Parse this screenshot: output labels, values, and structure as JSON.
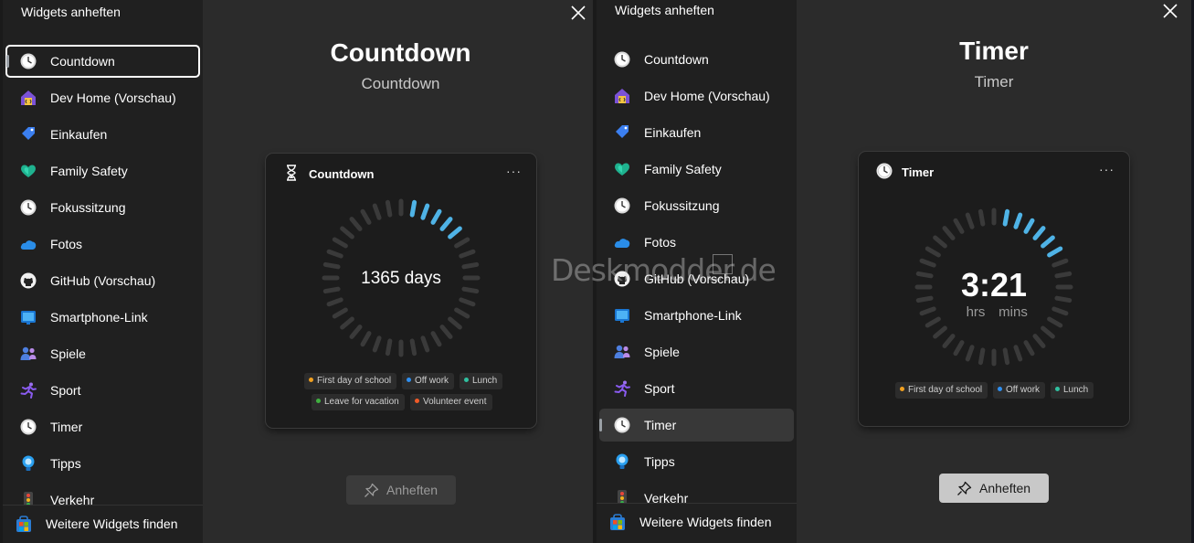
{
  "left": {
    "sidebar_title": "Widgets anheften",
    "items": [
      {
        "label": "Countdown",
        "icon": "clock-icon"
      },
      {
        "label": "Dev Home (Vorschau)",
        "icon": "dev-home-icon"
      },
      {
        "label": "Einkaufen",
        "icon": "shopping-tag-icon"
      },
      {
        "label": "Family Safety",
        "icon": "family-safety-heart-icon"
      },
      {
        "label": "Fokussitzung",
        "icon": "clock-icon"
      },
      {
        "label": "Fotos",
        "icon": "cloud-icon"
      },
      {
        "label": "GitHub (Vorschau)",
        "icon": "github-icon"
      },
      {
        "label": "Smartphone-Link",
        "icon": "phone-link-icon"
      },
      {
        "label": "Spiele",
        "icon": "games-icon"
      },
      {
        "label": "Sport",
        "icon": "runner-icon"
      },
      {
        "label": "Timer",
        "icon": "clock-icon"
      },
      {
        "label": "Tipps",
        "icon": "lightbulb-icon"
      },
      {
        "label": "Verkehr",
        "icon": "traffic-light-icon"
      }
    ],
    "footer_label": "Weitere Widgets finden",
    "title": "Countdown",
    "subtitle": "Countdown",
    "card": {
      "title": "Countdown",
      "more": "···",
      "value": "1365 days",
      "chips": [
        {
          "label": "First day of school",
          "color": "#f0a020"
        },
        {
          "label": "Off work",
          "color": "#2f8ff0"
        },
        {
          "label": "Lunch",
          "color": "#30c0a0"
        },
        {
          "label": "Leave for vacation",
          "color": "#40b040"
        },
        {
          "label": "Volunteer event",
          "color": "#f05a28"
        }
      ]
    },
    "pin_label": "Anheften"
  },
  "right": {
    "sidebar_title": "Widgets anheften",
    "items": [
      {
        "label": "Countdown",
        "icon": "clock-icon"
      },
      {
        "label": "Dev Home (Vorschau)",
        "icon": "dev-home-icon"
      },
      {
        "label": "Einkaufen",
        "icon": "shopping-tag-icon"
      },
      {
        "label": "Family Safety",
        "icon": "family-safety-heart-icon"
      },
      {
        "label": "Fokussitzung",
        "icon": "clock-icon"
      },
      {
        "label": "Fotos",
        "icon": "cloud-icon"
      },
      {
        "label": "GitHub (Vorschau)",
        "icon": "github-icon"
      },
      {
        "label": "Smartphone-Link",
        "icon": "phone-link-icon"
      },
      {
        "label": "Spiele",
        "icon": "games-icon"
      },
      {
        "label": "Sport",
        "icon": "runner-icon"
      },
      {
        "label": "Timer",
        "icon": "clock-icon"
      },
      {
        "label": "Tipps",
        "icon": "lightbulb-icon"
      },
      {
        "label": "Verkehr",
        "icon": "traffic-light-icon"
      }
    ],
    "footer_label": "Weitere Widgets finden",
    "title": "Timer",
    "subtitle": "Timer",
    "card": {
      "title": "Timer",
      "more": "···",
      "time": "3:21",
      "unit_hrs": "hrs",
      "unit_mins": "mins",
      "chips": [
        {
          "label": "First day of school",
          "color": "#f0a020"
        },
        {
          "label": "Off work",
          "color": "#2f8ff0"
        },
        {
          "label": "Lunch",
          "color": "#30c0a0"
        }
      ]
    },
    "pin_label": "Anheften"
  },
  "watermark": "Deskmodder.de",
  "colors": {
    "accent_ring": "#4fb3e6",
    "ring_base": "#3a3a3a"
  }
}
